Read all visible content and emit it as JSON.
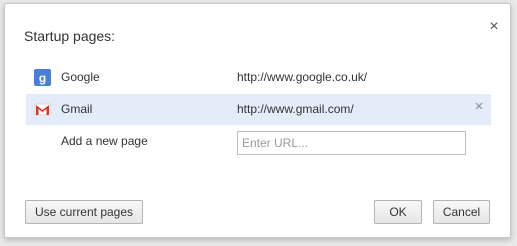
{
  "dialog": {
    "title": "Startup pages:",
    "close_glyph": "×"
  },
  "pages": [
    {
      "name": "Google",
      "url": "http://www.google.co.uk/",
      "icon": "google-g-icon",
      "icon_color": "#4a7fd6"
    },
    {
      "name": "Gmail",
      "url": "http://www.gmail.com/",
      "icon": "gmail-m-icon",
      "icon_color": "#d33a2c",
      "selected": true
    }
  ],
  "add_page": {
    "label": "Add a new page",
    "placeholder": "Enter URL..."
  },
  "remove_glyph": "×",
  "buttons": {
    "use_current": "Use current pages",
    "ok": "OK",
    "cancel": "Cancel"
  },
  "colors": {
    "selected_row": "#e3ecf8"
  }
}
